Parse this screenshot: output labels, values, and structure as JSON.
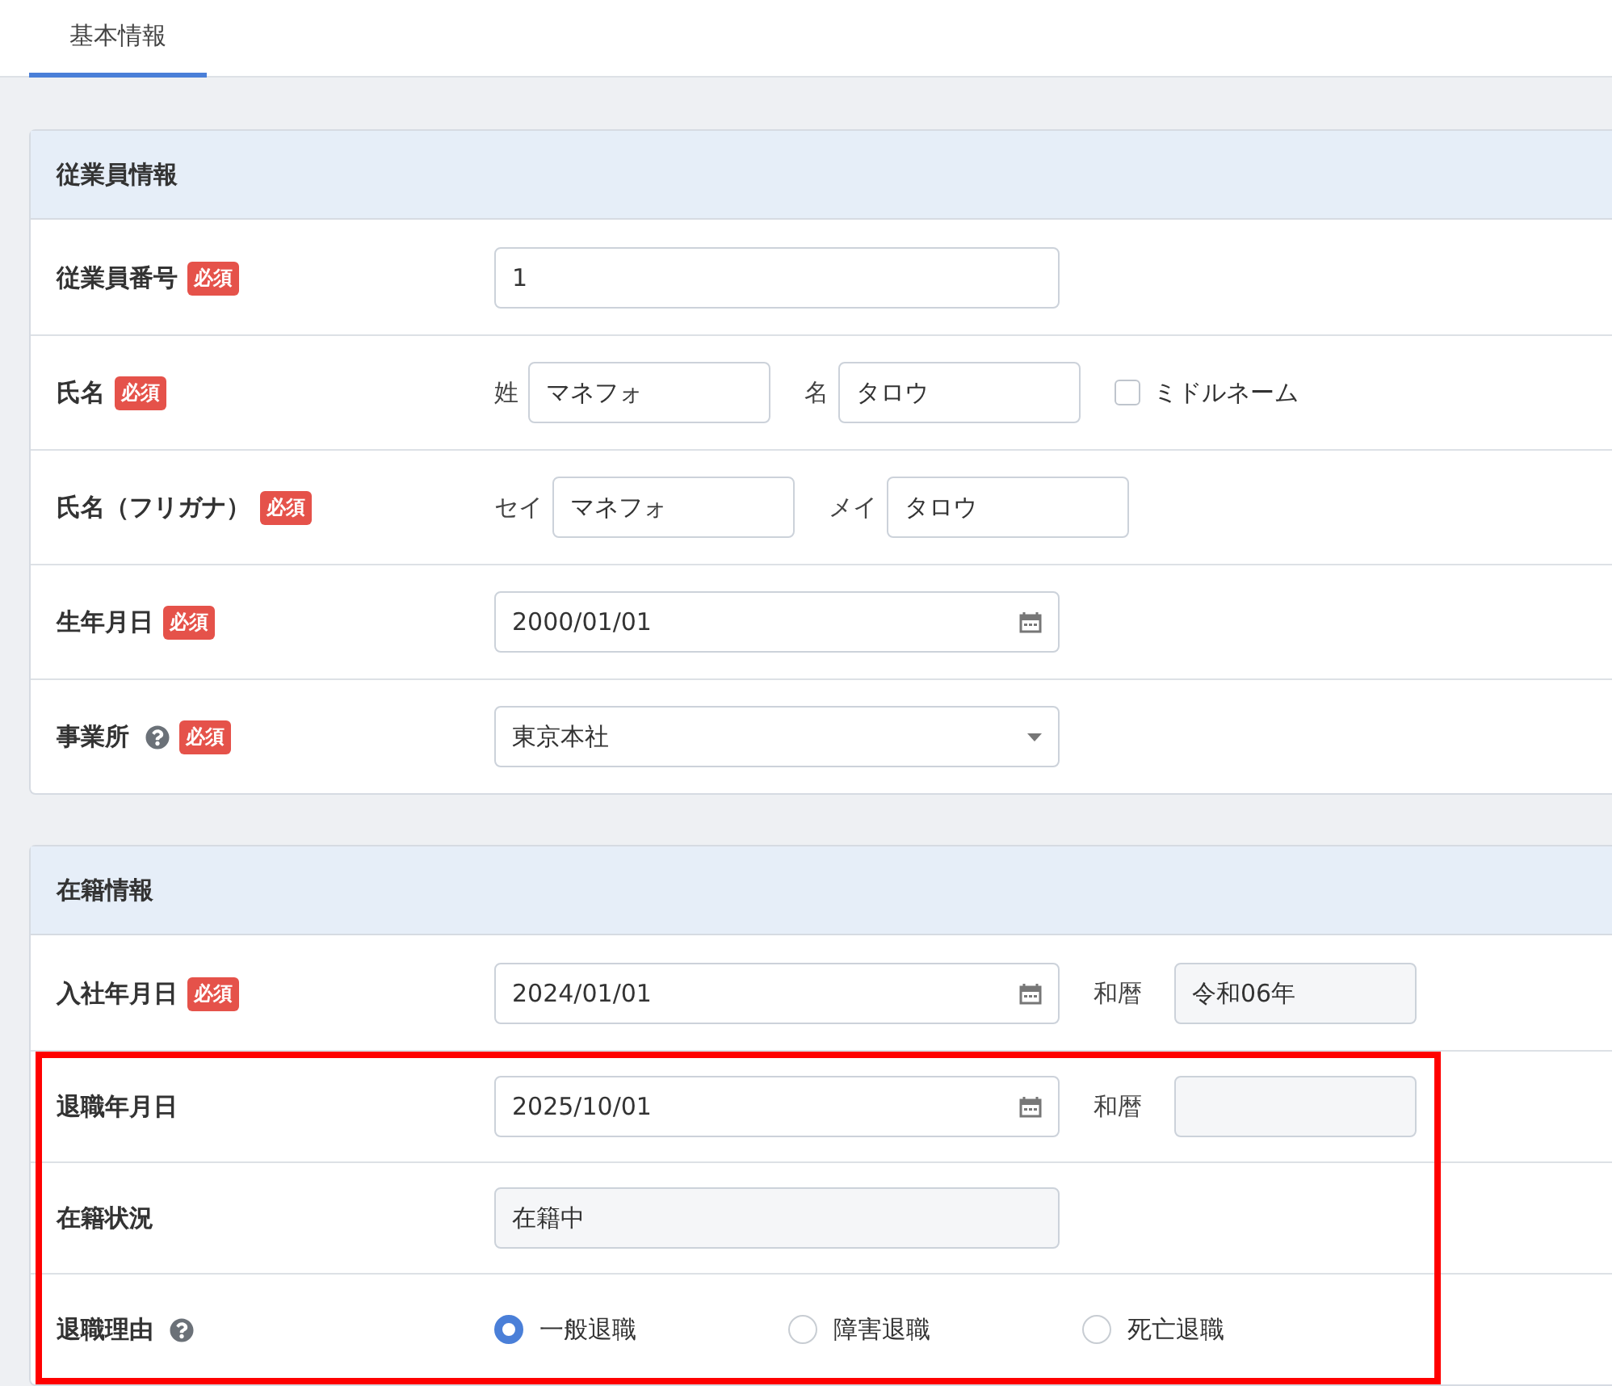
{
  "tabs": [
    {
      "label": "基本情報",
      "selected": true
    }
  ],
  "sections": [
    {
      "title": "従業員情報",
      "rows": [
        {
          "kind": "text",
          "label": "従業員番号",
          "required": "必須",
          "help": false,
          "highlighted": false,
          "value": "1"
        },
        {
          "kind": "name",
          "label": "氏名",
          "required": "必須",
          "help": false,
          "highlighted": false,
          "parts": [
            {
              "prefix": "姓",
              "value": "マネフォ"
            },
            {
              "prefix": "名",
              "value": "タロウ"
            }
          ],
          "checkbox": {
            "label": "ミドルネーム",
            "checked": false
          }
        },
        {
          "kind": "name",
          "label": "氏名（フリガナ）",
          "required": "必須",
          "help": false,
          "highlighted": false,
          "parts": [
            {
              "prefix": "セイ",
              "value": "マネフォ"
            },
            {
              "prefix": "メイ",
              "value": "タロウ"
            }
          ]
        },
        {
          "kind": "date",
          "label": "生年月日",
          "required": "必須",
          "help": false,
          "highlighted": false,
          "value": "2000/01/01"
        },
        {
          "kind": "select",
          "label": "事業所",
          "required": "必須",
          "help": true,
          "highlighted": false,
          "value": "東京本社"
        }
      ]
    },
    {
      "title": "在籍情報",
      "rows": [
        {
          "kind": "date",
          "label": "入社年月日",
          "required": "必須",
          "help": false,
          "highlighted": false,
          "value": "2024/01/01",
          "era": {
            "label": "和暦",
            "value": "令和06年"
          }
        },
        {
          "kind": "date",
          "label": "退職年月日",
          "help": false,
          "highlighted": true,
          "value": "2025/10/01",
          "era": {
            "label": "和暦"
          }
        },
        {
          "kind": "readonly",
          "label": "在籍状況",
          "help": false,
          "highlighted": true,
          "value": "在籍中"
        },
        {
          "kind": "radio",
          "label": "退職理由",
          "help": true,
          "highlighted": true,
          "options": [
            {
              "label": "一般退職",
              "selected": true
            },
            {
              "label": "障害退職",
              "selected": false
            },
            {
              "label": "死亡退職",
              "selected": false
            }
          ]
        }
      ]
    }
  ]
}
